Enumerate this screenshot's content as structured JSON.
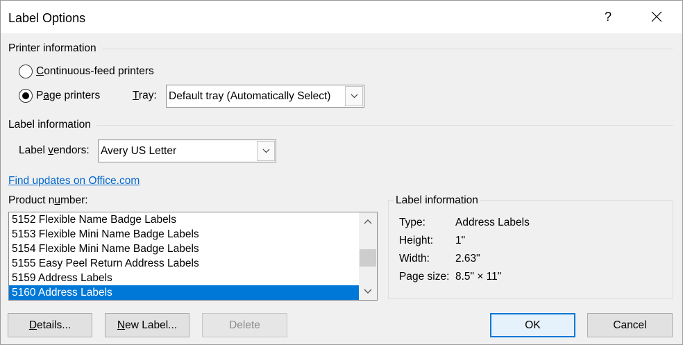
{
  "window": {
    "title": "Label Options",
    "help_label": "?"
  },
  "printer_info": {
    "heading": "Printer information",
    "options": [
      {
        "label": "Continuous-feed printers",
        "checked": false
      },
      {
        "label": "Page printers",
        "checked": true
      }
    ],
    "tray": {
      "label": "Tray:",
      "value": "Default tray (Automatically Select)"
    }
  },
  "label_info": {
    "heading": "Label information",
    "vendors": {
      "label": "Label vendors:",
      "value": "Avery US Letter"
    },
    "find_updates_link": "Find updates on Office.com"
  },
  "product_list": {
    "label": "Product number:",
    "items": [
      "5152 Flexible Name Badge Labels",
      "5153 Flexible Mini Name Badge Labels",
      "5154 Flexible Mini Name Badge Labels",
      "5155 Easy Peel Return Address Labels",
      "5159 Address Labels",
      "5160 Address Labels"
    ],
    "selected_index": 5,
    "scroll_position": 0.55
  },
  "details_panel": {
    "heading": "Label information",
    "rows": [
      {
        "label": "Type:",
        "value": "Address Labels"
      },
      {
        "label": "Height:",
        "value": "1\""
      },
      {
        "label": "Width:",
        "value": "2.63\""
      },
      {
        "label": "Page size:",
        "value": "8.5\" × 11\""
      }
    ]
  },
  "buttons": {
    "details": "Details...",
    "new_label": "New Label...",
    "delete": "Delete",
    "ok": "OK",
    "cancel": "Cancel",
    "delete_disabled": true,
    "ok_is_default": true
  },
  "icons": {
    "close": "close-icon",
    "dropdown": "chevron-down-icon",
    "scroll_up": "chevron-up-icon",
    "scroll_down": "chevron-down-icon"
  },
  "colors": {
    "accent": "#0078d7",
    "link": "#0066cc"
  }
}
